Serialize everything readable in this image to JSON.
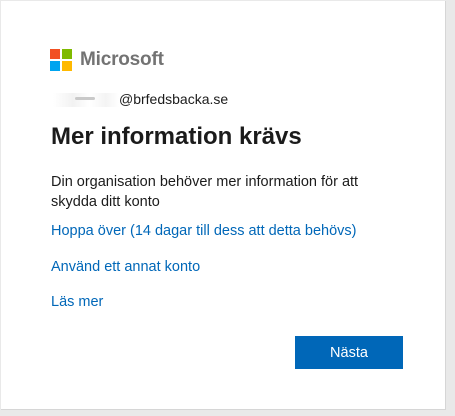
{
  "brand": {
    "name": "Microsoft",
    "logo_colors": [
      "#f25022",
      "#7fba00",
      "#00a4ef",
      "#ffb900"
    ]
  },
  "account": {
    "email_visible": "@brfedsbacka.se"
  },
  "page": {
    "title": "Mer information krävs",
    "description": "Din organisation behöver mer information för att skydda ditt konto"
  },
  "links": {
    "skip": "Hoppa över (14 dagar till dess att detta behövs)",
    "other_account": "Använd ett annat konto",
    "learn_more": "Läs mer"
  },
  "buttons": {
    "next": "Nästa"
  },
  "colors": {
    "accent": "#0067b8",
    "text": "#1b1b1b"
  }
}
